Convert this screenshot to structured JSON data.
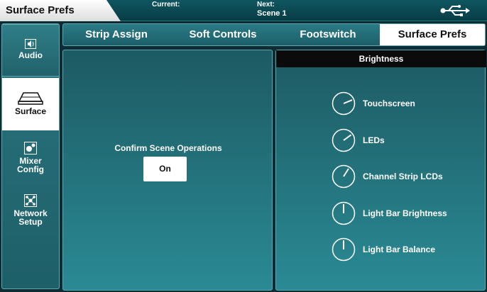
{
  "header": {
    "title": "Surface Prefs",
    "current_label": "Current:",
    "current_value": "",
    "next_label": "Next:",
    "next_value": "Scene 1"
  },
  "sidebar": {
    "items": [
      {
        "label": "Audio",
        "icon": "speaker-icon"
      },
      {
        "label": "Surface",
        "icon": "surface-icon",
        "active": true
      },
      {
        "label": "Mixer Config",
        "icon": "mixer-config-icon"
      },
      {
        "label": "Network Setup",
        "icon": "network-icon"
      }
    ]
  },
  "tabs": [
    {
      "label": "Strip Assign"
    },
    {
      "label": "Soft Controls"
    },
    {
      "label": "Footswitch"
    },
    {
      "label": "Surface Prefs",
      "active": true
    }
  ],
  "left_panel": {
    "confirm_label": "Confirm Scene Operations",
    "confirm_button": "On"
  },
  "brightness": {
    "header": "Brightness",
    "knobs": [
      {
        "label": "Touchscreen",
        "level": 0.75
      },
      {
        "label": "LEDs",
        "level": 0.7
      },
      {
        "label": "Channel Strip LCDs",
        "level": 0.62
      },
      {
        "label": "Light Bar Brightness",
        "level": 0.5
      },
      {
        "label": "Light Bar Balance",
        "level": 0.5
      }
    ]
  },
  "colors": {
    "accent": "#1d5a63",
    "active_tab": "#ffffff",
    "header_dark": "#0b0b0b"
  }
}
